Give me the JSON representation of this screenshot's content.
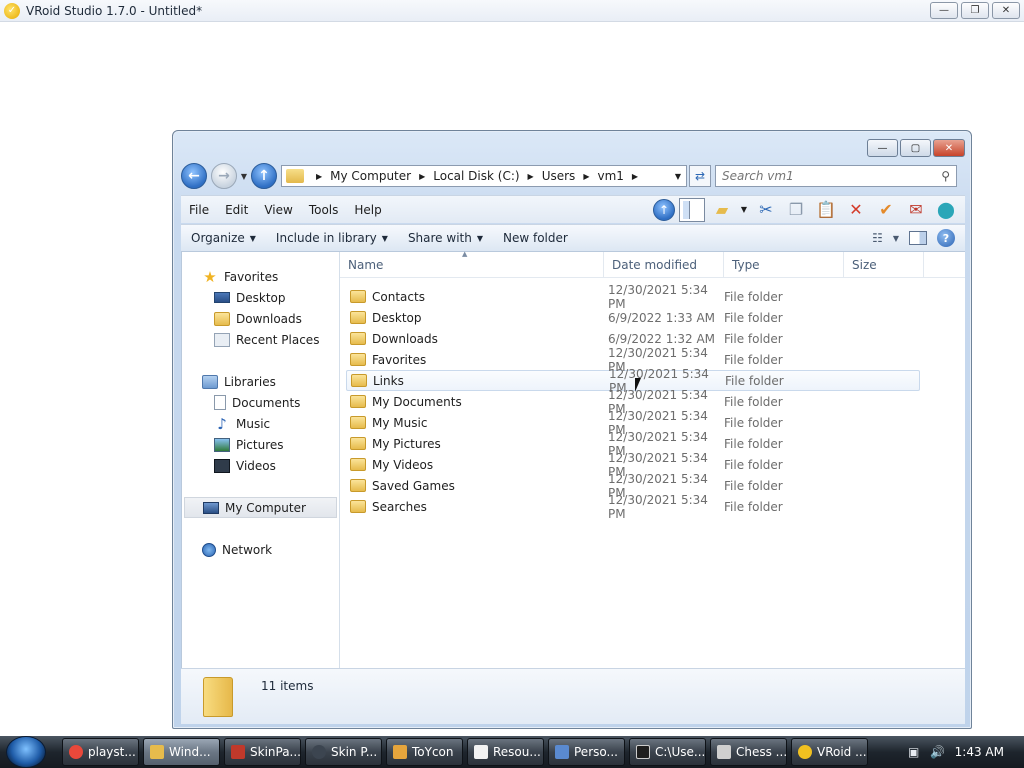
{
  "app": {
    "title": "VRoid Studio 1.7.0 - Untitled*",
    "minimize": "—",
    "maximize": "❐",
    "close": "✕"
  },
  "explorer": {
    "breadcrumb": [
      "My Computer",
      "Local Disk (C:)",
      "Users",
      "vm1"
    ],
    "search_placeholder": "Search vm1",
    "menu": [
      "File",
      "Edit",
      "View",
      "Tools",
      "Help"
    ],
    "commands": {
      "organize": "Organize",
      "include_in_library": "Include in library",
      "share_with": "Share with",
      "new_folder": "New folder"
    },
    "columns": {
      "name": "Name",
      "date": "Date modified",
      "type": "Type",
      "size": "Size"
    },
    "nav": {
      "favorites": "Favorites",
      "desktop": "Desktop",
      "downloads": "Downloads",
      "recent": "Recent Places",
      "libraries": "Libraries",
      "documents": "Documents",
      "music": "Music",
      "pictures": "Pictures",
      "videos": "Videos",
      "computer": "My Computer",
      "network": "Network"
    },
    "files": [
      {
        "name": "Contacts",
        "date": "12/30/2021 5:34 PM",
        "type": "File folder"
      },
      {
        "name": "Desktop",
        "date": "6/9/2022 1:33 AM",
        "type": "File folder"
      },
      {
        "name": "Downloads",
        "date": "6/9/2022 1:32 AM",
        "type": "File folder"
      },
      {
        "name": "Favorites",
        "date": "12/30/2021 5:34 PM",
        "type": "File folder"
      },
      {
        "name": "Links",
        "date": "12/30/2021 5:34 PM",
        "type": "File folder"
      },
      {
        "name": "My Documents",
        "date": "12/30/2021 5:34 PM",
        "type": "File folder"
      },
      {
        "name": "My Music",
        "date": "12/30/2021 5:34 PM",
        "type": "File folder"
      },
      {
        "name": "My Pictures",
        "date": "12/30/2021 5:34 PM",
        "type": "File folder"
      },
      {
        "name": "My Videos",
        "date": "12/30/2021 5:34 PM",
        "type": "File folder"
      },
      {
        "name": "Saved Games",
        "date": "12/30/2021 5:34 PM",
        "type": "File folder"
      },
      {
        "name": "Searches",
        "date": "12/30/2021 5:34 PM",
        "type": "File folder"
      }
    ],
    "item_count": "11 items"
  },
  "taskbar": {
    "tasks": [
      {
        "label": "playst...",
        "color": "#e9483b"
      },
      {
        "label": "Wind...",
        "color": "#e6bb4c"
      },
      {
        "label": "SkinPa...",
        "color": "#c0392b"
      },
      {
        "label": "Skin P...",
        "color": "#3c4550"
      },
      {
        "label": "ToYcon",
        "color": "#e6a53c"
      },
      {
        "label": "Resou...",
        "color": "#f2f2f2"
      },
      {
        "label": "Perso...",
        "color": "#5a8ad0"
      },
      {
        "label": "C:\\Use...",
        "color": "#1e1e1e"
      },
      {
        "label": "Chess ...",
        "color": "#cfcfcf"
      },
      {
        "label": "VRoid ...",
        "color": "#f0c020"
      }
    ],
    "clock": "1:43 AM"
  }
}
